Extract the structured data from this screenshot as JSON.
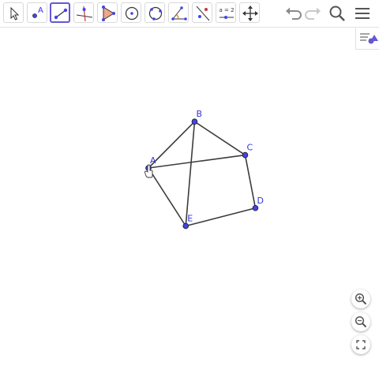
{
  "toolbar": {
    "tools": [
      {
        "name": "move",
        "active": false
      },
      {
        "name": "point",
        "active": false,
        "glyph": "A"
      },
      {
        "name": "segment",
        "active": true
      },
      {
        "name": "perpendicular-line",
        "active": false
      },
      {
        "name": "polygon",
        "active": false
      },
      {
        "name": "circle-with-center",
        "active": false
      },
      {
        "name": "circle-through-points",
        "active": false
      },
      {
        "name": "angle",
        "active": false
      },
      {
        "name": "reflect-about-line",
        "active": false
      },
      {
        "name": "slider",
        "active": false,
        "glyph": "a = 2"
      },
      {
        "name": "move-graphics-view",
        "active": false
      }
    ],
    "right_buttons": [
      "undo-icon",
      "redo-icon",
      "search-icon",
      "menu-icon"
    ]
  },
  "construction": {
    "points": [
      {
        "label": "A",
        "x": 0,
        "y": 0
      },
      {
        "label": "B",
        "x": 1.67,
        "y": 1.68
      },
      {
        "label": "C",
        "x": 3.5,
        "y": 0.47
      },
      {
        "label": "D",
        "x": 3.87,
        "y": -1.45
      },
      {
        "label": "E",
        "x": 1.35,
        "y": -2.1
      }
    ],
    "segments": [
      [
        "A",
        "B"
      ],
      [
        "B",
        "C"
      ],
      [
        "C",
        "D"
      ],
      [
        "D",
        "E"
      ],
      [
        "E",
        "A"
      ],
      [
        "A",
        "C"
      ],
      [
        "B",
        "E"
      ]
    ]
  },
  "colors": {
    "point": "#4343ea",
    "segment": "#3c3c3c",
    "accent": "#6557d2",
    "label": "#3434d9"
  }
}
